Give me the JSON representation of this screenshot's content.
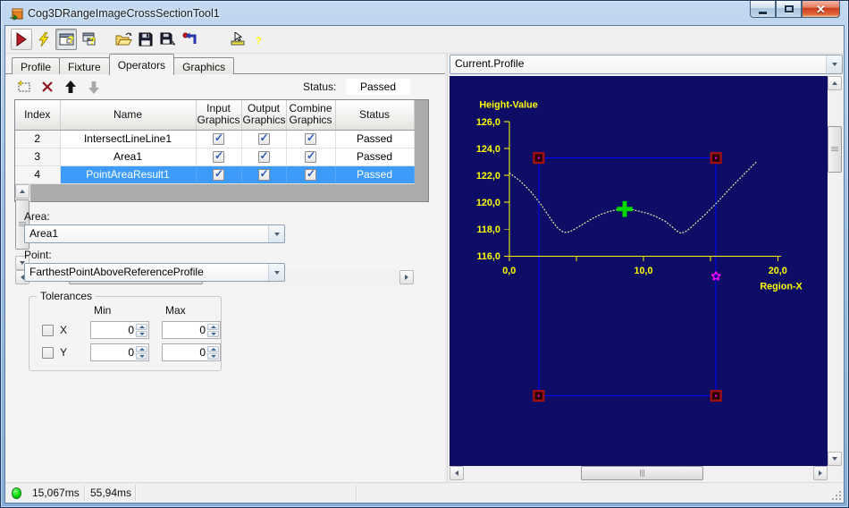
{
  "window": {
    "title": "Cog3DRangeImageCrossSectionTool1"
  },
  "toolbar": {
    "icons": [
      {
        "name": "run-tool-icon"
      },
      {
        "name": "run-tool-electric-icon"
      },
      {
        "name": "show-result-display-icon",
        "pressed": true
      },
      {
        "name": "float-result-display-icon"
      },
      {
        "name": "open-tool-icon"
      },
      {
        "name": "save-tool-icon"
      },
      {
        "name": "save-tool-as-icon"
      },
      {
        "name": "reset-tool-icon"
      },
      {
        "name": "measure-units-icon"
      },
      {
        "name": "help-icon"
      }
    ]
  },
  "tabs": {
    "items": [
      {
        "label": "Profile",
        "active": false
      },
      {
        "label": "Fixture",
        "active": false
      },
      {
        "label": "Operators",
        "active": true
      },
      {
        "label": "Graphics",
        "active": false
      }
    ]
  },
  "operators_panel": {
    "toolbar": {
      "icons": [
        {
          "name": "add-operator-icon"
        },
        {
          "name": "delete-operator-icon"
        },
        {
          "name": "move-operator-up-icon"
        },
        {
          "name": "move-operator-down-icon",
          "disabled": true
        }
      ],
      "status_label": "Status:",
      "status_value": "Passed"
    },
    "table": {
      "columns": [
        "Index",
        "Name",
        "Input Graphics",
        "Output Graphics",
        "Combine Graphics",
        "Status"
      ],
      "rows": [
        {
          "index": "2",
          "name": "IntersectLineLine1",
          "input_graphics": true,
          "output_graphics": true,
          "combine_graphics": true,
          "status": "Passed",
          "selected": false
        },
        {
          "index": "3",
          "name": "Area1",
          "input_graphics": true,
          "output_graphics": true,
          "combine_graphics": true,
          "status": "Passed",
          "selected": false
        },
        {
          "index": "4",
          "name": "PointAreaResult1",
          "input_graphics": true,
          "output_graphics": true,
          "combine_graphics": true,
          "status": "Passed",
          "selected": true
        }
      ]
    },
    "area": {
      "label": "Area:",
      "value": "Area1"
    },
    "point": {
      "label": "Point:",
      "value": "FarthestPointAboveReferenceProfile"
    },
    "tolerances": {
      "title": "Tolerances",
      "min_header": "Min",
      "max_header": "Max",
      "rows": [
        {
          "label": "X",
          "checked": false,
          "min": "0",
          "max": "0"
        },
        {
          "label": "Y",
          "checked": false,
          "min": "0",
          "max": "0"
        }
      ]
    }
  },
  "display_panel": {
    "selector_value": "Current.Profile"
  },
  "chart_data": {
    "type": "line",
    "title": "Current.Profile",
    "xlabel": "Region-X",
    "ylabel": "Height-Value",
    "xlim": [
      0,
      20
    ],
    "ylim": [
      116,
      126
    ],
    "background": "#0d0d66",
    "axis_color": "#ffff00",
    "x_ticks": [
      {
        "v": 0,
        "label": "0,0"
      },
      {
        "v": 5,
        "label": ""
      },
      {
        "v": 10,
        "label": "10,0"
      },
      {
        "v": 15,
        "label": ""
      },
      {
        "v": 20,
        "label": "20,0"
      }
    ],
    "y_ticks": [
      {
        "v": 116,
        "label": "116,0"
      },
      {
        "v": 118,
        "label": "118,0"
      },
      {
        "v": 120,
        "label": "120,0"
      },
      {
        "v": 122,
        "label": "122,0"
      },
      {
        "v": 124,
        "label": "124,0"
      },
      {
        "v": 126,
        "label": "126,0"
      }
    ],
    "series": [
      {
        "name": "profile-curve",
        "color": "#ffffb0",
        "x": [
          0.0,
          0.4,
          0.8,
          1.2,
          1.6,
          2.0,
          2.4,
          2.8,
          3.2,
          3.6,
          4.0,
          4.3,
          4.7,
          5.2,
          5.7,
          6.2,
          6.8,
          7.4,
          8.0,
          8.6,
          9.2,
          9.8,
          10.4,
          11.0,
          11.6,
          12.1,
          12.5,
          12.8,
          13.1,
          13.5,
          14.0,
          14.5,
          15.0,
          15.5,
          16.0,
          16.5,
          17.0,
          17.5,
          18.0,
          18.4
        ],
        "y": [
          122.2,
          121.9,
          121.6,
          121.2,
          120.8,
          120.3,
          119.8,
          119.2,
          118.6,
          118.1,
          117.8,
          117.75,
          117.9,
          118.2,
          118.5,
          118.8,
          119.1,
          119.3,
          119.45,
          119.5,
          119.45,
          119.3,
          119.15,
          118.9,
          118.6,
          118.2,
          117.85,
          117.7,
          117.8,
          118.1,
          118.55,
          119.0,
          119.5,
          120.0,
          120.55,
          121.1,
          121.6,
          122.1,
          122.6,
          123.0
        ]
      }
    ],
    "region_box": {
      "x_min": 2.2,
      "x_max": 15.4,
      "y_max": 123.3,
      "y_min": 105.6,
      "color": "#0000ff",
      "handle_color": "#a01010",
      "handle_dot_color": "#ff00ff"
    },
    "markers": [
      {
        "type": "cross",
        "name": "farthest-point-marker",
        "x": 8.6,
        "y": 119.5,
        "color": "#00d800"
      },
      {
        "type": "flower",
        "name": "result-point-marker",
        "x": 15.4,
        "y": 114.5,
        "color": "#ff00ff"
      }
    ]
  },
  "status_bar": {
    "execution_time": "15,067ms",
    "result_time": "55,94ms"
  }
}
